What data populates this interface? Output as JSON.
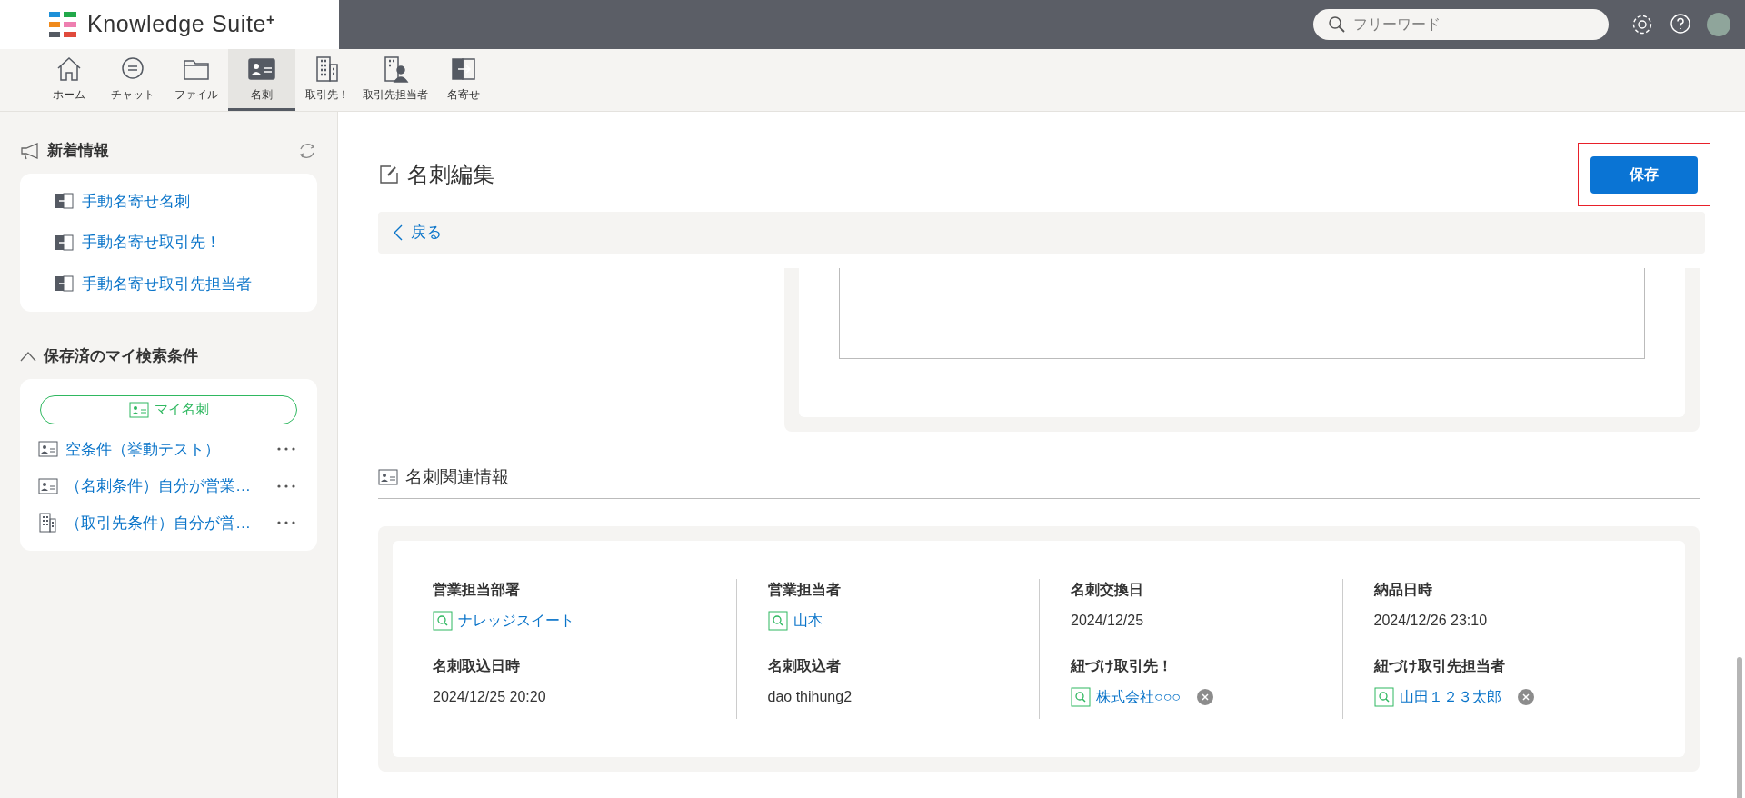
{
  "header": {
    "logo": "Knowledge Suite",
    "logo_mark": "+",
    "search": {
      "placeholder": "フリーワード"
    }
  },
  "nav": [
    {
      "label": "ホーム",
      "kind": "home",
      "selected": false
    },
    {
      "label": "チャット",
      "kind": "chat",
      "selected": false
    },
    {
      "label": "ファイル",
      "kind": "folder",
      "selected": false
    },
    {
      "label": "名刺",
      "kind": "card",
      "selected": true
    },
    {
      "label": "取引先！",
      "kind": "building",
      "selected": false
    },
    {
      "label": "取引先担当者",
      "kind": "person",
      "selected": false
    },
    {
      "label": "名寄せ",
      "kind": "merge",
      "selected": false
    }
  ],
  "sidebar": {
    "news": {
      "title": "新着情報",
      "items": [
        "手動名寄せ名刺",
        "手動名寄せ取引先！",
        "手動名寄せ取引先担当者"
      ]
    },
    "saved": {
      "title": "保存済のマイ検索条件",
      "expanded": true,
      "pill": "マイ名刺",
      "items": [
        {
          "label": "空条件（挙動テスト）",
          "kind": "card"
        },
        {
          "label": "（名刺条件）自分が営業…",
          "kind": "card"
        },
        {
          "label": "（取引先条件）自分が営…",
          "kind": "building"
        }
      ]
    }
  },
  "main": {
    "title": "名刺編集",
    "save": "保存",
    "back": "戻る",
    "section": "名刺関連情報",
    "columns": [
      [
        {
          "label": "営業担当部署",
          "value": "ナレッジスイート",
          "kind": "link"
        },
        {
          "label": "名刺取込日時",
          "value": "2024/12/25 20:20",
          "kind": "text"
        }
      ],
      [
        {
          "label": "営業担当者",
          "value": "山本",
          "kind": "link"
        },
        {
          "label": "名刺取込者",
          "value": "dao thihung2",
          "kind": "text"
        }
      ],
      [
        {
          "label": "名刺交換日",
          "value": "2024/12/25",
          "kind": "text"
        },
        {
          "label": "紐づけ取引先！",
          "value": "株式会社○○○",
          "kind": "removable"
        }
      ],
      [
        {
          "label": "納品日時",
          "value": "2024/12/26 23:10",
          "kind": "text"
        },
        {
          "label": "紐づけ取引先担当者",
          "value": "山田１２３太郎",
          "kind": "removable"
        }
      ]
    ]
  }
}
